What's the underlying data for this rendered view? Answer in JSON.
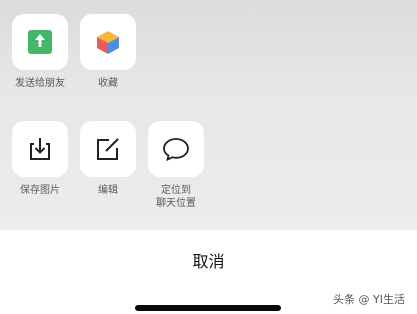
{
  "share_sheet": {
    "row1": [
      {
        "label": "发送给朋友",
        "icon": "send-to-friend-icon"
      },
      {
        "label": "收藏",
        "icon": "favorites-cube-icon"
      }
    ],
    "row2": [
      {
        "label": "保存图片",
        "icon": "save-image-icon"
      },
      {
        "label": "编辑",
        "icon": "edit-icon"
      },
      {
        "label": "定位到\n聊天位置",
        "icon": "chat-bubble-icon"
      }
    ],
    "cancel_label": "取消"
  },
  "watermark": "头条 @ YI生活",
  "colors": {
    "accent_green": "#43b968",
    "sheet_background": "#e8e8e8",
    "text": "#111111"
  }
}
